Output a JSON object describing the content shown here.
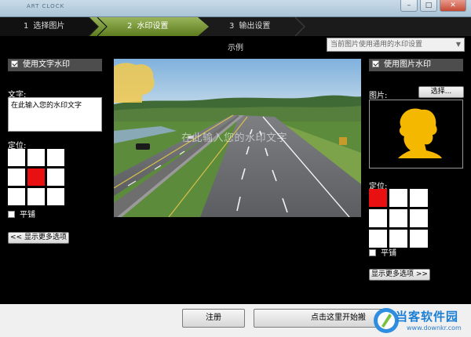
{
  "window": {
    "app_title": "ART CLOCK",
    "minimize_glyph": "–",
    "maximize_glyph": "□",
    "close_glyph": "✕"
  },
  "steps": [
    {
      "num": "1",
      "label": "选择图片"
    },
    {
      "num": "2",
      "label": "水印设置"
    },
    {
      "num": "3",
      "label": "输出设置"
    }
  ],
  "header": {
    "example_label": "示例",
    "dropdown_value": "当前图片使用通用的水印设置"
  },
  "text_watermark": {
    "enable_label": "使用文字水印",
    "enabled": true,
    "text_label": "文字:",
    "text_value": "在此输入您的水印文字",
    "position_label": "定位:",
    "selected_cell": 4,
    "tile_label": "平铺",
    "tile_checked": false,
    "more_button": "<< 显示更多选项"
  },
  "preview": {
    "watermark_text": "在此输入您的水印文字"
  },
  "image_watermark": {
    "enable_label": "使用图片水印",
    "enabled": true,
    "image_label": "图片:",
    "choose_button": "选择...",
    "position_label": "定位:",
    "selected_cell": 0,
    "tile_label": "平铺",
    "tile_checked": false,
    "more_button": "显示更多选项 >>"
  },
  "footer": {
    "register_button": "注册",
    "start_button": "点击这里开始搬",
    "brand_name": "当客软件园",
    "brand_url": "www.downkr.com"
  },
  "colors": {
    "active_step": "#6f8f2a",
    "selected_cell": "#e81010",
    "silhouette": "#f5b800",
    "brand": "#1b7fd4"
  }
}
